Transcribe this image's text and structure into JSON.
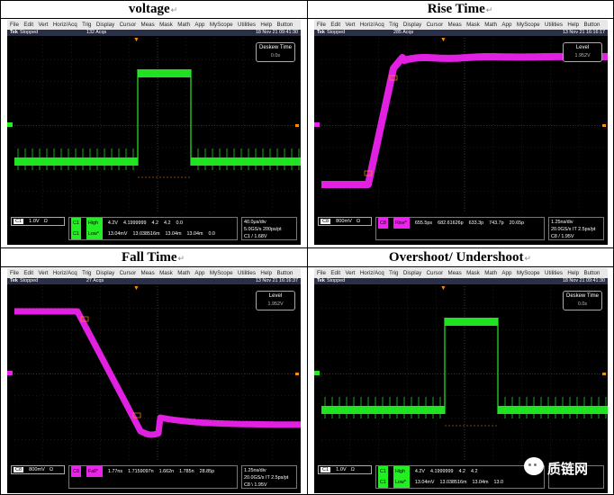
{
  "panels": [
    {
      "title": "voltage",
      "status": {
        "stopped": "Stopped",
        "acqs": "132 Acqs",
        "date": "18 Nov 21 09:41:30"
      },
      "overlay": {
        "label": "Deskew Time",
        "value": "0.0s"
      },
      "channel": {
        "tag": "C1",
        "scale": "1.0V",
        "unit": "Ω"
      },
      "meas_rows": [
        [
          "C1",
          "High",
          "4.2V",
          "4.1999999",
          "4.2",
          "4.2",
          "0.0"
        ],
        [
          "C1",
          "Low*",
          "13.04mV",
          "13.038516m",
          "13.04m",
          "13.04m",
          "0.0"
        ]
      ],
      "timebase": [
        "40.0μs/div",
        "5.0GS/s  200ps/pt",
        "C1 / 1.68V"
      ]
    },
    {
      "title": "Rise Time",
      "status": {
        "stopped": "Stopped",
        "acqs": "285 Acqs",
        "date": "13 Nov 21 16:16:17"
      },
      "overlay": {
        "label": "Level",
        "value": "1.952V"
      },
      "channel": {
        "tag": "C8",
        "scale": "800mV",
        "unit": "Ω"
      },
      "meas_rows": [
        [
          "C8",
          "Rise*",
          "655.5ps",
          "682.61626p",
          "633.3p",
          "743.7p",
          "20.65p"
        ]
      ],
      "timebase": [
        "1.25ns/div",
        "20.0GS/s IT 2.5ps/pt",
        "C8 / 1.95V"
      ]
    },
    {
      "title": "Fall Time",
      "status": {
        "stopped": "Stopped",
        "acqs": "27 Acqs",
        "date": "13 Nov 21 16:16:37"
      },
      "overlay": {
        "label": "Level",
        "value": "1.952V"
      },
      "channel": {
        "tag": "C8",
        "scale": "800mV",
        "unit": "Ω"
      },
      "meas_rows": [
        [
          "C8",
          "Fall*",
          "1.77ns",
          "1.7159097n",
          "1.662n",
          "1.785n",
          "28.85p"
        ]
      ],
      "timebase": [
        "1.25ns/div",
        "20.0GS/s IT 2.5ps/pt",
        "C8 \\ 1.95V"
      ]
    },
    {
      "title": "Overshoot/ Undershoot",
      "status": {
        "stopped": "Stopped",
        "acqs": "",
        "date": "18 Nov 21 09:41:30"
      },
      "overlay": {
        "label": "Deskew Time",
        "value": "0.0s"
      },
      "channel": {
        "tag": "C1",
        "scale": "1.0V",
        "unit": "Ω"
      },
      "meas_rows": [
        [
          "C1",
          "High",
          "4.2V",
          "4.1999999",
          "4.2",
          "4.2",
          ""
        ],
        [
          "C1",
          "Low*",
          "13.04mV",
          "13.038516m",
          "13.04m",
          "13.0",
          ""
        ]
      ],
      "timebase": [
        "",
        "",
        ""
      ]
    }
  ],
  "menu": [
    "File",
    "Edit",
    "Vert",
    "Horiz/Acq",
    "Trig",
    "Display",
    "Cursor",
    "Meas",
    "Mask",
    "Math",
    "App",
    "MyScope",
    "Utilities",
    "Help",
    "Button"
  ],
  "tek_label": "Tek",
  "return_mark": "↵",
  "watermark": "质链网",
  "colors": {
    "green": "#22ee22",
    "magenta": "#ee22ee",
    "background": "#000000"
  }
}
